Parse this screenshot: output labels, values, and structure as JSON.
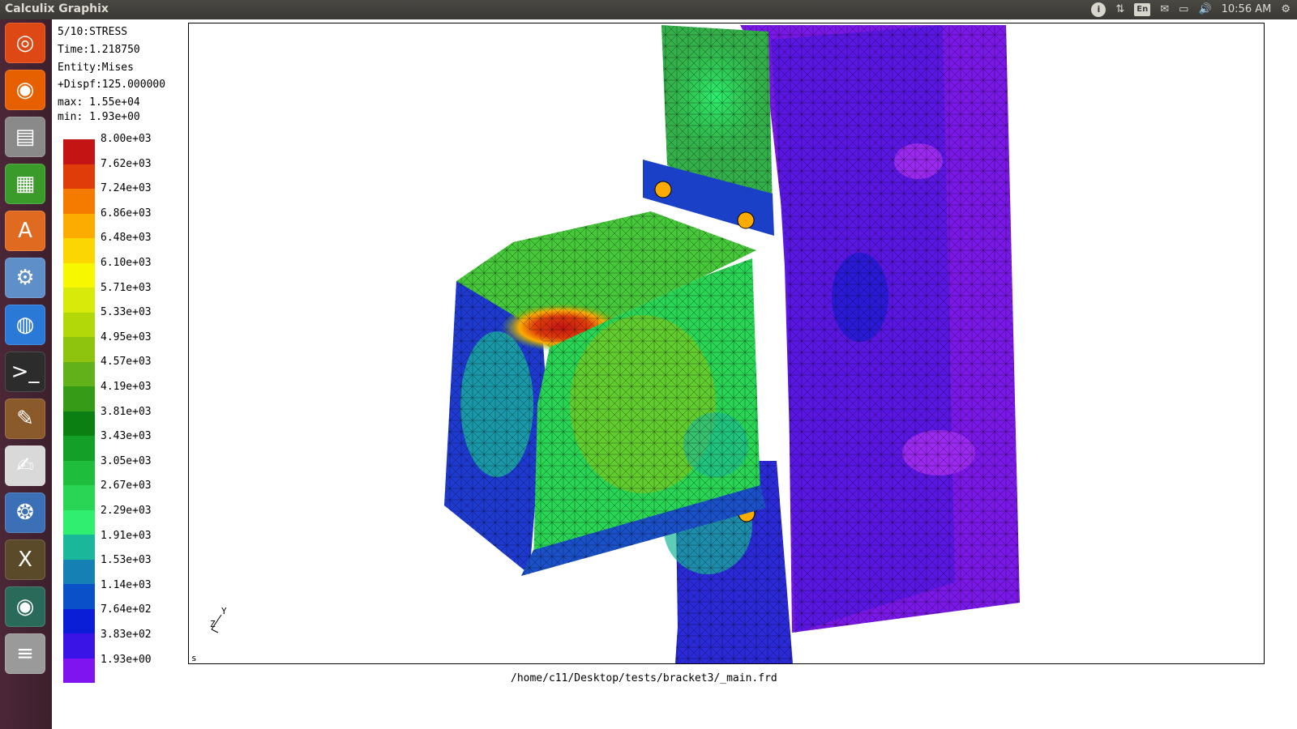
{
  "window": {
    "title": "Calculix Graphix"
  },
  "panel": {
    "indicators": [
      {
        "name": "info-icon",
        "glyph": "i"
      },
      {
        "name": "network-updown-icon",
        "glyph": "⇅"
      },
      {
        "name": "keyboard-layout-icon",
        "glyph": "En"
      },
      {
        "name": "mail-icon",
        "glyph": "✉"
      },
      {
        "name": "battery-icon",
        "glyph": "▭"
      },
      {
        "name": "volume-icon",
        "glyph": "🔊"
      }
    ],
    "clock": "10:56 AM",
    "settings_icon": "⚙"
  },
  "launcher": {
    "items": [
      {
        "name": "ubuntu-dash-icon",
        "glyph": "◎",
        "color": "#dd4814"
      },
      {
        "name": "firefox-icon",
        "glyph": "◉",
        "color": "#e66000"
      },
      {
        "name": "files-icon",
        "glyph": "▤",
        "color": "#8a8a8a"
      },
      {
        "name": "spreadsheet-icon",
        "glyph": "▦",
        "color": "#3a9a2a"
      },
      {
        "name": "software-center-icon",
        "glyph": "A",
        "color": "#e06a20"
      },
      {
        "name": "settings-icon",
        "glyph": "⚙",
        "color": "#5f8fc8"
      },
      {
        "name": "chrome-icon",
        "glyph": "◍",
        "color": "#2b79d6"
      },
      {
        "name": "terminal-icon",
        "glyph": ">_",
        "color": "#2c2c2c"
      },
      {
        "name": "paint-icon",
        "glyph": "✎",
        "color": "#8b5a2b"
      },
      {
        "name": "text-editor-icon",
        "glyph": "✍",
        "color": "#d9d9d9"
      },
      {
        "name": "gimp-icon",
        "glyph": "❂",
        "color": "#3b6fb6"
      },
      {
        "name": "xterm-icon",
        "glyph": "X",
        "color": "#5a4a2a"
      },
      {
        "name": "webcam-icon",
        "glyph": "◉",
        "color": "#2a6a5a"
      },
      {
        "name": "workspace-stack-icon",
        "glyph": "≡",
        "color": "#9a9a9a"
      }
    ]
  },
  "result_info": {
    "step": "5/10:STRESS",
    "time": "Time:1.218750",
    "entity": "Entity:Mises",
    "dispf": "+Dispf:125.000000",
    "max": "max: 1.55e+04",
    "min": "min: 1.93e+00"
  },
  "legend": {
    "levels": [
      {
        "label": "8.00e+03",
        "color": "#c41414"
      },
      {
        "label": "7.62e+03",
        "color": "#e03c0a"
      },
      {
        "label": "7.24e+03",
        "color": "#f57a00"
      },
      {
        "label": "6.86e+03",
        "color": "#fcac00"
      },
      {
        "label": "6.48e+03",
        "color": "#fcd600"
      },
      {
        "label": "6.10e+03",
        "color": "#f7f700"
      },
      {
        "label": "5.71e+03",
        "color": "#d7ea0a"
      },
      {
        "label": "5.33e+03",
        "color": "#b2d80a"
      },
      {
        "label": "4.95e+03",
        "color": "#8ec40e"
      },
      {
        "label": "4.57e+03",
        "color": "#62b01a"
      },
      {
        "label": "4.19e+03",
        "color": "#349c16"
      },
      {
        "label": "3.81e+03",
        "color": "#0a8012"
      },
      {
        "label": "3.43e+03",
        "color": "#14a028"
      },
      {
        "label": "3.05e+03",
        "color": "#1ebe3c"
      },
      {
        "label": "2.67e+03",
        "color": "#2ad454"
      },
      {
        "label": "2.29e+03",
        "color": "#2ef06e"
      },
      {
        "label": "1.91e+03",
        "color": "#1ab89a"
      },
      {
        "label": "1.53e+03",
        "color": "#1480b4"
      },
      {
        "label": "1.14e+03",
        "color": "#0a50c8"
      },
      {
        "label": "7.64e+02",
        "color": "#0a1ed8"
      },
      {
        "label": "3.83e+02",
        "color": "#3a14e6"
      },
      {
        "label": "1.93e+00",
        "color": "#8014f0"
      }
    ]
  },
  "viewport": {
    "axis_y": "Y",
    "axis_z": "Z",
    "corner_mark": "s"
  },
  "status": {
    "file_path": "/home/c11/Desktop/tests/bracket3/_main.frd"
  }
}
